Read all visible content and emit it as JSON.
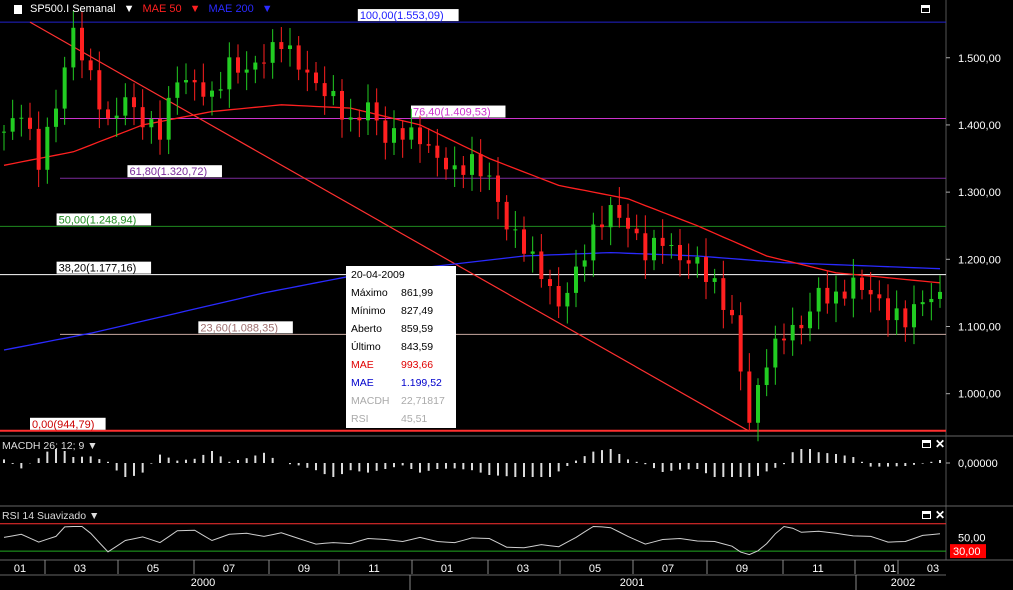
{
  "header": {
    "symbol": "SP500.I Semanal",
    "ma1": "MAE 50",
    "ma2": "MAE 200",
    "symbol_color": "#ffffff",
    "ma1_color": "#ff2020",
    "ma2_color": "#2a2aff"
  },
  "tooltip": {
    "date": "20-04-2009",
    "rows": [
      {
        "label": "Máximo",
        "value": "861,99",
        "color": "#000000"
      },
      {
        "label": "Mínimo",
        "value": "827,49",
        "color": "#000000"
      },
      {
        "label": "Aberto",
        "value": "859,59",
        "color": "#000000"
      },
      {
        "label": "Último",
        "value": "843,59",
        "color": "#000000"
      },
      {
        "label": "MAE",
        "value": "993,66",
        "color": "#e00000"
      },
      {
        "label": "MAE",
        "value": "1.199,52",
        "color": "#0000cc"
      },
      {
        "label": "MACDH",
        "value": "22,71817",
        "color": "#aaaaaa"
      },
      {
        "label": "RSI",
        "value": "45,51",
        "color": "#aaaaaa"
      }
    ]
  },
  "panes": {
    "macd_title": "MACDH 26; 12; 9",
    "rsi_title": "RSI 14 Suavizado",
    "macd_axis_label": "0,00000",
    "rsi_axis_label": "50,00",
    "rsi_current": "30,00"
  },
  "chart_data": {
    "type": "candlestick",
    "y_range": [
      940,
      1580
    ],
    "y_ticks": [
      {
        "value": 1500,
        "label": "1.500,00"
      },
      {
        "value": 1400,
        "label": "1.400,00"
      },
      {
        "value": 1300,
        "label": "1.300,00"
      },
      {
        "value": 1200,
        "label": "1.200,00"
      },
      {
        "value": 1100,
        "label": "1.100,00"
      },
      {
        "value": 1000,
        "label": "1.000,00"
      }
    ],
    "fib_levels": [
      {
        "value": 1553.09,
        "label": "100,00(1.553,09)",
        "color": "#2222cc",
        "label_color": "#1c1cff",
        "pos": 0.37
      },
      {
        "value": 1409.53,
        "label": "76,40(1.409,53)",
        "color": "#cc33cc",
        "label_color": "#cc33cc",
        "pos": 0.43
      },
      {
        "value": 1320.72,
        "label": "61,80(1.320,72)",
        "color": "#7a2a9a",
        "label_color": "#7a2a9a",
        "pos": 0.11
      },
      {
        "value": 1248.94,
        "label": "50,00(1.248,94)",
        "color": "#1f8a1f",
        "label_color": "#1f8a1f",
        "pos": 0.03
      },
      {
        "value": 1177.16,
        "label": "38,20(1.177,16)",
        "color": "#ffffff",
        "label_color": "#000000",
        "pos": 0.03
      },
      {
        "value": 1088.35,
        "label": "23,60(1.088,35)",
        "color": "#c8a8a0",
        "label_color": "#a07070",
        "pos": 0.19
      },
      {
        "value": 944.79,
        "label": "0,00(944,79)",
        "color": "#ff3030",
        "label_color": "#cc0000",
        "pos": 0.0
      }
    ],
    "x_month_labels": [
      "01",
      "03",
      "05",
      "07",
      "09",
      "11",
      "01",
      "03",
      "05",
      "07",
      "09",
      "11",
      "01",
      "03"
    ],
    "x_year_labels": [
      "2000",
      "2001",
      "2002"
    ],
    "trendline": {
      "from": [
        3,
        1553
      ],
      "to": [
        86,
        944
      ]
    },
    "ohlc_weeks": 109,
    "close_path": [
      [
        0,
        1390
      ],
      [
        2,
        1420
      ],
      [
        4,
        1345
      ],
      [
        6,
        1430
      ],
      [
        8,
        1540
      ],
      [
        10,
        1470
      ],
      [
        12,
        1400
      ],
      [
        14,
        1440
      ],
      [
        16,
        1405
      ],
      [
        18,
        1390
      ],
      [
        20,
        1470
      ],
      [
        22,
        1460
      ],
      [
        24,
        1440
      ],
      [
        26,
        1490
      ],
      [
        28,
        1480
      ],
      [
        30,
        1500
      ],
      [
        32,
        1525
      ],
      [
        34,
        1490
      ],
      [
        36,
        1460
      ],
      [
        38,
        1440
      ],
      [
        40,
        1400
      ],
      [
        42,
        1430
      ],
      [
        44,
        1380
      ],
      [
        46,
        1390
      ],
      [
        48,
        1380
      ],
      [
        50,
        1350
      ],
      [
        52,
        1330
      ],
      [
        54,
        1345
      ],
      [
        56,
        1320
      ],
      [
        58,
        1250
      ],
      [
        60,
        1220
      ],
      [
        62,
        1180
      ],
      [
        64,
        1130
      ],
      [
        66,
        1180
      ],
      [
        68,
        1240
      ],
      [
        70,
        1275
      ],
      [
        72,
        1250
      ],
      [
        74,
        1210
      ],
      [
        76,
        1230
      ],
      [
        78,
        1200
      ],
      [
        80,
        1195
      ],
      [
        82,
        1160
      ],
      [
        84,
        1110
      ],
      [
        86,
        960
      ],
      [
        88,
        1050
      ],
      [
        90,
        1090
      ],
      [
        92,
        1100
      ],
      [
        94,
        1150
      ],
      [
        96,
        1140
      ],
      [
        98,
        1165
      ],
      [
        100,
        1150
      ],
      [
        102,
        1120
      ],
      [
        104,
        1110
      ],
      [
        106,
        1140
      ],
      [
        108,
        1145
      ]
    ],
    "ma50_path": [
      [
        0,
        1340
      ],
      [
        8,
        1360
      ],
      [
        16,
        1400
      ],
      [
        24,
        1420
      ],
      [
        32,
        1430
      ],
      [
        40,
        1425
      ],
      [
        48,
        1400
      ],
      [
        56,
        1350
      ],
      [
        64,
        1310
      ],
      [
        72,
        1290
      ],
      [
        80,
        1250
      ],
      [
        88,
        1205
      ],
      [
        96,
        1180
      ],
      [
        104,
        1170
      ],
      [
        108,
        1165
      ]
    ],
    "ma200_path": [
      [
        0,
        1065
      ],
      [
        10,
        1090
      ],
      [
        20,
        1120
      ],
      [
        30,
        1150
      ],
      [
        40,
        1175
      ],
      [
        50,
        1190
      ],
      [
        60,
        1205
      ],
      [
        70,
        1210
      ],
      [
        80,
        1205
      ],
      [
        90,
        1195
      ],
      [
        100,
        1190
      ],
      [
        108,
        1186
      ]
    ]
  }
}
